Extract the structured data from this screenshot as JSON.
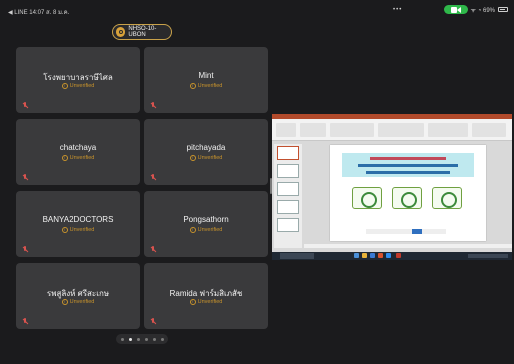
{
  "status_bar": {
    "left": "◀ LINE  14:07  ส. 8 ม.ค.",
    "center": "•••",
    "right_text": "ᯤ ◔ 69%"
  },
  "meeting": {
    "id": "NHSO-10-UBON",
    "accent": "#c9a24a"
  },
  "participants": [
    {
      "name": "โรงพยาบาลราษีไศล",
      "status": "Unverified"
    },
    {
      "name": "Mint",
      "status": "Unverified"
    },
    {
      "name": "chatchaya",
      "status": "Unverified"
    },
    {
      "name": "pitchayada",
      "status": "Unverified"
    },
    {
      "name": "BANYA2DOCTORS",
      "status": "Unverified"
    },
    {
      "name": "Pongsathorn",
      "status": "Unverified"
    },
    {
      "name": "รพสูลิงห์ ศรีสะเกษ",
      "status": "Unverified"
    },
    {
      "name": "Ramida ฟาร์มสิเภสัช",
      "status": "Unverified"
    }
  ],
  "page_indicator": {
    "total": 6,
    "active_index": 1
  },
  "colors": {
    "tile_bg": "#3a3a3c",
    "unverified": "#c9942c",
    "mic_off": "#d9534f",
    "video_on": "#2fb84a"
  }
}
